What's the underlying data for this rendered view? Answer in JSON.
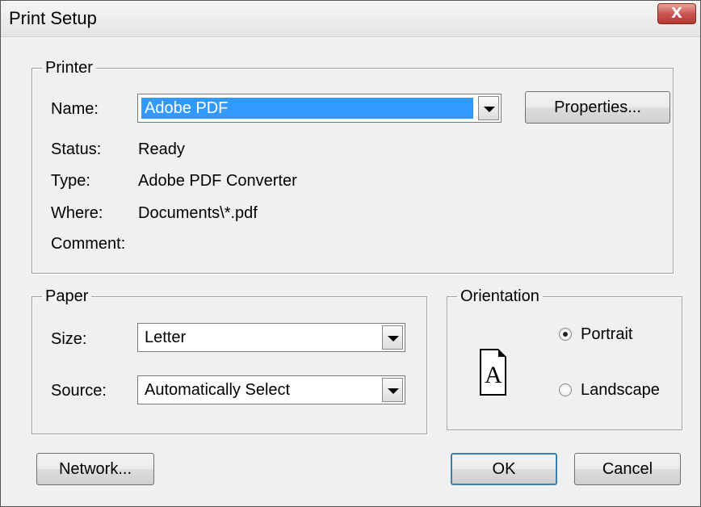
{
  "window": {
    "title": "Print Setup",
    "close_glyph": "X"
  },
  "printer": {
    "legend": "Printer",
    "name_label": "Name:",
    "name_value": "Adobe PDF",
    "properties_button": "Properties...",
    "status_label": "Status:",
    "status_value": "Ready",
    "type_label": "Type:",
    "type_value": "Adobe PDF Converter",
    "where_label": "Where:",
    "where_value": "Documents\\*.pdf",
    "comment_label": "Comment:",
    "comment_value": ""
  },
  "paper": {
    "legend": "Paper",
    "size_label": "Size:",
    "size_value": "Letter",
    "source_label": "Source:",
    "source_value": "Automatically Select"
  },
  "orientation": {
    "legend": "Orientation",
    "page_letter": "A",
    "portrait_label": "Portrait",
    "landscape_label": "Landscape",
    "selected": "Portrait"
  },
  "buttons": {
    "network": "Network...",
    "ok": "OK",
    "cancel": "Cancel"
  },
  "colors": {
    "selection": "#3399ff",
    "close_button": "#c75050",
    "background": "#f0f0f0"
  },
  "icons": [
    "close-icon",
    "dropdown-arrow-icon",
    "page-portrait-icon",
    "radio-icon"
  ]
}
